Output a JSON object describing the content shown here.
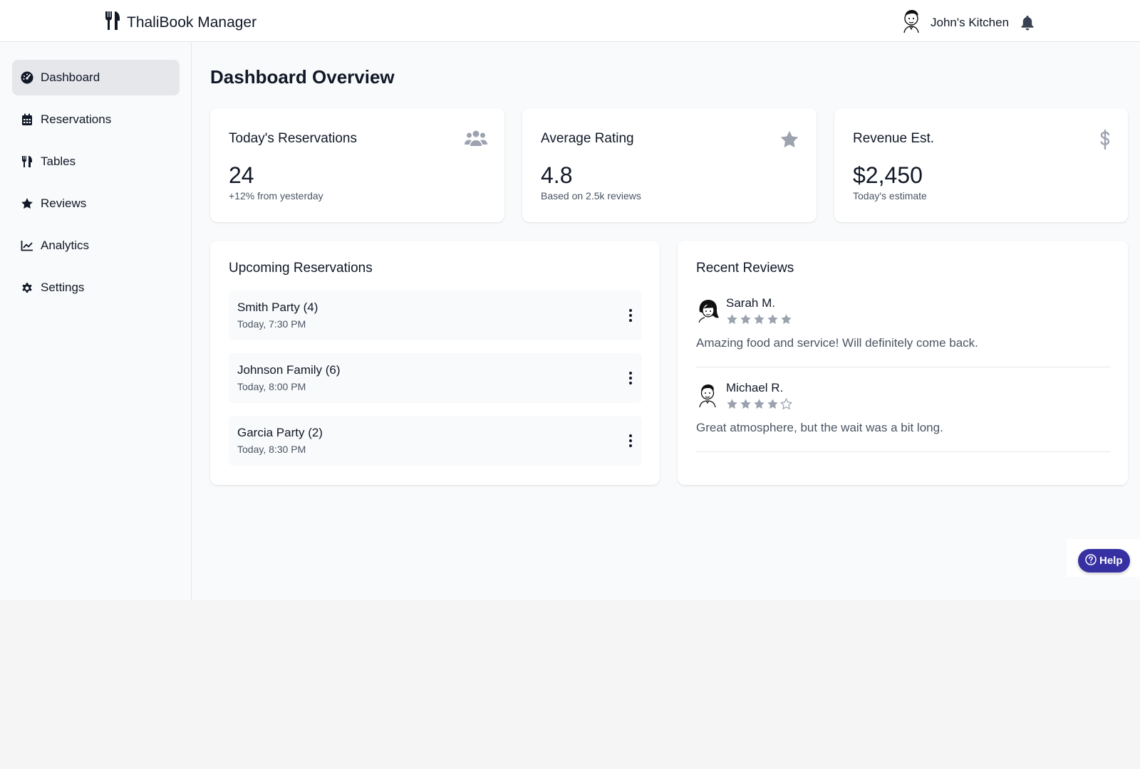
{
  "header": {
    "brand_icon": "utensils-icon",
    "brand_title": "ThaliBook Manager",
    "user_name": "John's Kitchen",
    "notification_icon": "bell-icon"
  },
  "sidebar": {
    "items": [
      {
        "label": "Dashboard",
        "icon": "gauge-icon",
        "active": true
      },
      {
        "label": "Reservations",
        "icon": "calendar-icon"
      },
      {
        "label": "Tables",
        "icon": "utensils-icon"
      },
      {
        "label": "Reviews",
        "icon": "star-icon"
      },
      {
        "label": "Analytics",
        "icon": "chart-line-icon"
      },
      {
        "label": "Settings",
        "icon": "gear-icon"
      }
    ]
  },
  "main": {
    "title": "Dashboard Overview",
    "stats": [
      {
        "label": "Today's Reservations",
        "value": "24",
        "sub": "+12% from yesterday",
        "icon": "users-icon"
      },
      {
        "label": "Average Rating",
        "value": "4.8",
        "sub": "Based on 2.5k reviews",
        "icon": "star-icon"
      },
      {
        "label": "Revenue Est.",
        "value": "$2,450",
        "sub": "Today's estimate",
        "icon": "dollar-icon"
      }
    ],
    "upcoming": {
      "title": "Upcoming Reservations",
      "items": [
        {
          "name": "Smith Party (4)",
          "time": "Today, 7:30 PM"
        },
        {
          "name": "Johnson Family (6)",
          "time": "Today, 8:00 PM"
        },
        {
          "name": "Garcia Party (2)",
          "time": "Today, 8:30 PM"
        }
      ]
    },
    "reviews": {
      "title": "Recent Reviews",
      "items": [
        {
          "name": "Sarah M.",
          "rating": 5,
          "text": "Amazing food and service! Will definitely come back."
        },
        {
          "name": "Michael R.",
          "rating": 4,
          "text": "Great atmosphere, but the wait was a bit long."
        }
      ]
    }
  },
  "help": {
    "label": "Help",
    "icon": "question-circle-icon"
  },
  "colors": {
    "accent": "#3730a3",
    "star": "#9ca3af",
    "muted_icon": "#9ca3af"
  }
}
